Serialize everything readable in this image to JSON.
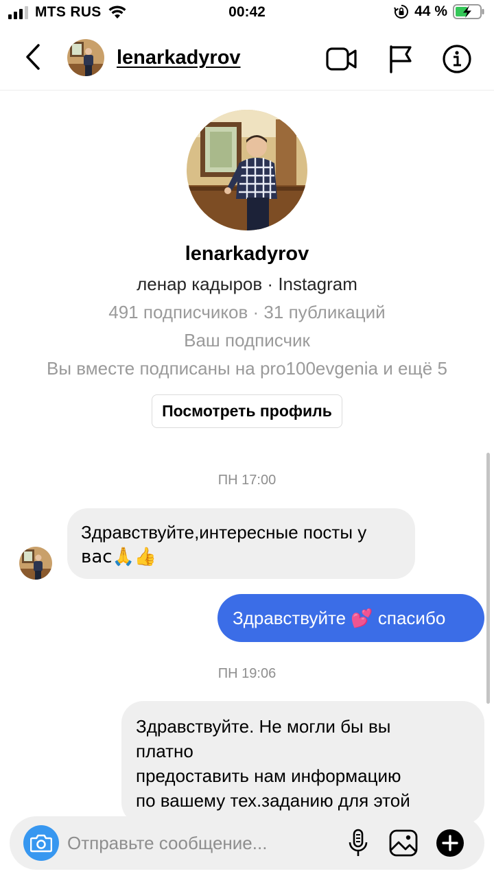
{
  "status_bar": {
    "carrier": "MTS RUS",
    "time": "00:42",
    "battery_percent": "44 %"
  },
  "header": {
    "username": "lenarkadyrov",
    "icons": [
      "back-chevron-icon",
      "video-call-icon",
      "flag-icon",
      "info-icon"
    ]
  },
  "profile": {
    "username": "lenarkadyrov",
    "name_line": "ленар кадыров · Instagram",
    "stats": "491 подписчиков · 31 публикаций",
    "follows_you": "Ваш подписчик",
    "mutual": "Вы вместе подписаны на pro100evgenia и ещё 5",
    "view_profile_label": "Посмотреть профиль"
  },
  "chat": {
    "timestamp_1": "ПН 17:00",
    "msg_in_1_line1": "Здравствуйте,интересные посты у",
    "msg_in_1_line2": "вас🙏👍",
    "msg_out_1": "Здравствуйте 💕  спасибо",
    "timestamp_2": "ПН 19:06",
    "msg_out_2_lines": [
      "Здравствуйте. Не могли бы вы",
      "платно",
      "предоставить нам информацию",
      "по вашему тех.заданию для этой"
    ]
  },
  "composer": {
    "placeholder": "Отправьте сообщение...",
    "icons": [
      "camera-icon",
      "microphone-icon",
      "gallery-icon",
      "plus-icon"
    ]
  },
  "colors": {
    "outgoing_bubble": "#3b6de7",
    "incoming_bubble": "#efefef",
    "camera_button": "#3797f0",
    "muted_text": "#9a9a9a"
  }
}
